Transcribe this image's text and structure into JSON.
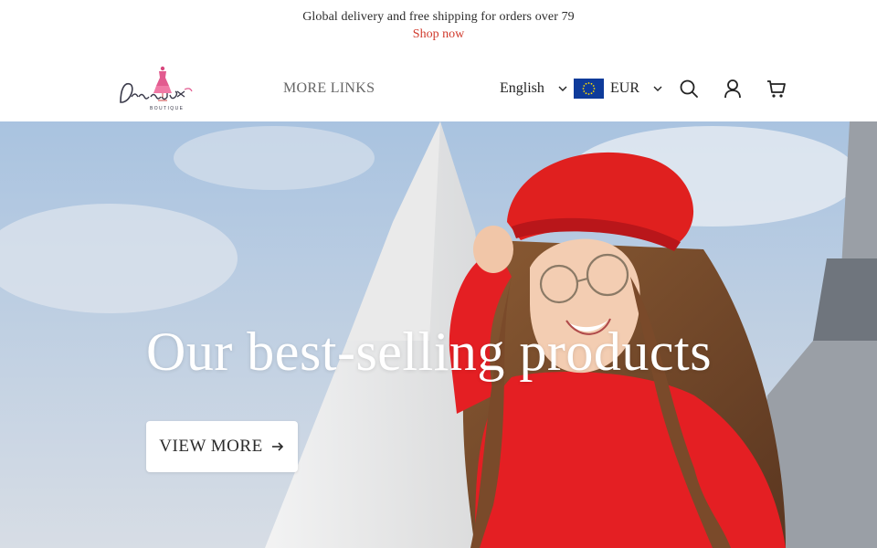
{
  "announcement": {
    "text": "Global delivery and free shipping for orders over 79",
    "link_label": "Shop now"
  },
  "header": {
    "logo_alt": "Dressupx Boutique",
    "nav": {
      "more_links": "MORE LINKS"
    },
    "language": {
      "selected": "English"
    },
    "currency": {
      "selected": "EUR",
      "flag": "eu-flag"
    },
    "icons": [
      "search-icon",
      "account-icon",
      "cart-icon"
    ]
  },
  "hero": {
    "title": "Our best-selling products",
    "button_label": "VIEW MORE",
    "button_icon": "arrow-right-icon"
  },
  "colors": {
    "accent_link": "#d0392b",
    "beret_red": "#e0201f",
    "flag_blue": "#0e3b9a",
    "flag_stars": "#ffdd00"
  }
}
